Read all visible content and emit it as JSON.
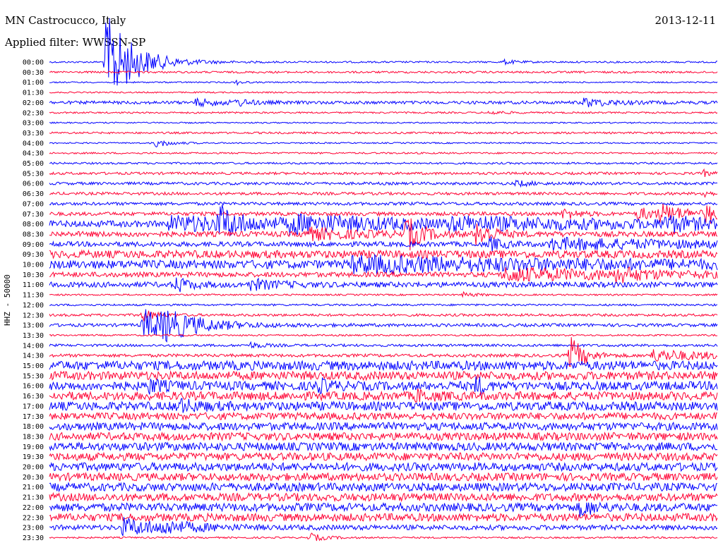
{
  "header": {
    "station": "MN Castrocucco, Italy",
    "date": "2013-12-11",
    "filter": "Applied filter: WWSSN-SP"
  },
  "colors": {
    "blue": "#0000ff",
    "red": "#ff0033",
    "text": "#000000"
  },
  "chart_data": {
    "type": "helicorder",
    "ylabel": "HHZ - 50000",
    "series_colors": [
      "#0000ff",
      "#ff0033"
    ],
    "rows": [
      {
        "label": "00:00",
        "noise": 1.2,
        "events": [
          [
            0.085,
            70,
            0.04
          ],
          [
            0.68,
            3,
            0.02
          ]
        ]
      },
      {
        "label": "00:30",
        "noise": 1.4,
        "events": []
      },
      {
        "label": "01:00",
        "noise": 1.0,
        "events": [
          [
            0.28,
            3,
            0.01
          ]
        ]
      },
      {
        "label": "01:30",
        "noise": 1.0,
        "events": []
      },
      {
        "label": "02:00",
        "noise": 2.2,
        "events": [
          [
            0.22,
            5,
            0.04
          ],
          [
            0.28,
            4,
            0.02
          ],
          [
            0.8,
            6,
            0.04
          ]
        ]
      },
      {
        "label": "02:30",
        "noise": 1.2,
        "events": [
          [
            0.66,
            3,
            0.02
          ]
        ]
      },
      {
        "label": "03:00",
        "noise": 1.0,
        "events": []
      },
      {
        "label": "03:30",
        "noise": 1.4,
        "events": []
      },
      {
        "label": "04:00",
        "noise": 1.0,
        "events": [
          [
            0.16,
            6,
            0.02
          ]
        ]
      },
      {
        "label": "04:30",
        "noise": 1.2,
        "events": []
      },
      {
        "label": "05:00",
        "noise": 1.4,
        "events": []
      },
      {
        "label": "05:30",
        "noise": 1.8,
        "events": [
          [
            0.98,
            4,
            0.01
          ]
        ]
      },
      {
        "label": "06:00",
        "noise": 2.0,
        "events": [
          [
            0.7,
            4,
            0.02
          ]
        ]
      },
      {
        "label": "06:30",
        "noise": 2.0,
        "events": [
          [
            0.98,
            10,
            0.005
          ]
        ]
      },
      {
        "label": "07:00",
        "noise": 2.2,
        "events": []
      },
      {
        "label": "07:30",
        "noise": 2.6,
        "events": [
          [
            0.77,
            8,
            0.02
          ],
          [
            0.88,
            8,
            0.04
          ],
          [
            0.915,
            10,
            0.04
          ],
          [
            0.985,
            18,
            0.01
          ]
        ]
      },
      {
        "label": "08:00",
        "noise": 4.5,
        "events": [
          [
            0.18,
            9,
            0.25
          ],
          [
            0.255,
            22,
            0.02
          ],
          [
            0.36,
            8,
            0.15
          ],
          [
            0.6,
            6,
            0.3
          ],
          [
            0.92,
            10,
            0.04
          ]
        ]
      },
      {
        "label": "08:30",
        "noise": 3.8,
        "events": [
          [
            0.38,
            8,
            0.08
          ],
          [
            0.535,
            25,
            0.02
          ],
          [
            0.64,
            20,
            0.02
          ]
        ]
      },
      {
        "label": "09:00",
        "noise": 3.5,
        "events": [
          [
            0.66,
            9,
            0.02
          ],
          [
            0.75,
            7,
            0.25
          ]
        ]
      },
      {
        "label": "09:30",
        "noise": 5.5,
        "events": []
      },
      {
        "label": "10:00",
        "noise": 6.0,
        "events": [
          [
            0.45,
            9,
            0.35
          ]
        ]
      },
      {
        "label": "10:30",
        "noise": 3.5,
        "events": [
          [
            0.68,
            9,
            0.2
          ],
          [
            0.85,
            8,
            0.03
          ]
        ]
      },
      {
        "label": "11:00",
        "noise": 3.8,
        "events": [
          [
            0.19,
            10,
            0.02
          ],
          [
            0.3,
            7,
            0.04
          ]
        ]
      },
      {
        "label": "11:30",
        "noise": 1.2,
        "events": [
          [
            0.62,
            3,
            0.02
          ]
        ]
      },
      {
        "label": "12:00",
        "noise": 1.4,
        "events": []
      },
      {
        "label": "12:30",
        "noise": 1.8,
        "events": [
          [
            0.14,
            8,
            0.02
          ]
        ]
      },
      {
        "label": "13:00",
        "noise": 2.2,
        "events": [
          [
            0.14,
            22,
            0.06
          ],
          [
            0.17,
            12,
            0.05
          ]
        ]
      },
      {
        "label": "13:30",
        "noise": 1.2,
        "events": []
      },
      {
        "label": "14:00",
        "noise": 1.8,
        "events": [
          [
            0.3,
            4,
            0.02
          ]
        ]
      },
      {
        "label": "14:30",
        "noise": 2.2,
        "events": [
          [
            0.78,
            28,
            0.02
          ],
          [
            0.9,
            8,
            0.1
          ]
        ]
      },
      {
        "label": "15:00",
        "noise": 6.5,
        "events": []
      },
      {
        "label": "15:30",
        "noise": 6.0,
        "events": []
      },
      {
        "label": "16:00",
        "noise": 6.2,
        "events": [
          [
            0.15,
            8,
            0.02
          ],
          [
            0.4,
            8,
            0.02
          ],
          [
            0.64,
            14,
            0.01
          ]
        ]
      },
      {
        "label": "16:30",
        "noise": 6.0,
        "events": [
          [
            0.55,
            7,
            0.02
          ]
        ]
      },
      {
        "label": "17:00",
        "noise": 6.2,
        "events": [
          [
            0.19,
            8,
            0.03
          ]
        ]
      },
      {
        "label": "17:30",
        "noise": 5.0,
        "events": []
      },
      {
        "label": "18:00",
        "noise": 5.5,
        "events": []
      },
      {
        "label": "18:30",
        "noise": 5.5,
        "events": []
      },
      {
        "label": "19:00",
        "noise": 5.8,
        "events": []
      },
      {
        "label": "19:30",
        "noise": 5.5,
        "events": []
      },
      {
        "label": "20:00",
        "noise": 5.8,
        "events": []
      },
      {
        "label": "20:30",
        "noise": 5.5,
        "events": []
      },
      {
        "label": "21:00",
        "noise": 5.8,
        "events": []
      },
      {
        "label": "21:30",
        "noise": 5.5,
        "events": []
      },
      {
        "label": "22:00",
        "noise": 5.8,
        "events": [
          [
            0.795,
            11,
            0.02
          ]
        ]
      },
      {
        "label": "22:30",
        "noise": 5.5,
        "events": []
      },
      {
        "label": "23:00",
        "noise": 3.5,
        "events": [
          [
            0.11,
            12,
            0.06
          ],
          [
            0.17,
            5,
            0.05
          ]
        ]
      },
      {
        "label": "23:30",
        "noise": 1.2,
        "events": [
          [
            0.39,
            6,
            0.02
          ]
        ]
      }
    ]
  }
}
